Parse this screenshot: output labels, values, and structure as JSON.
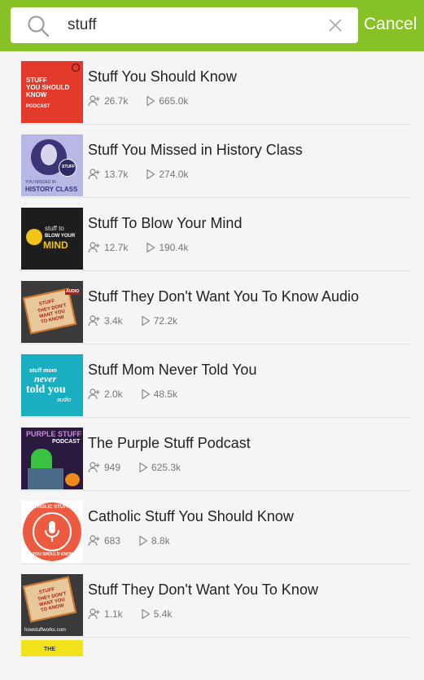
{
  "search": {
    "query": "stuff",
    "cancel_label": "Cancel"
  },
  "colors": {
    "accent": "#86c125",
    "background": "#f5f5f5"
  },
  "results": [
    {
      "title": "Stuff You Should Know",
      "subscribers": "26.7k",
      "plays": "665.0k",
      "art_text": [
        "STUFF",
        "YOU SHOULD",
        "KNOW",
        "PODCAST"
      ]
    },
    {
      "title": "Stuff You Missed in History Class",
      "subscribers": "13.7k",
      "plays": "274.0k",
      "art_text": [
        "STUFF",
        "YOU MISSED IN",
        "HISTORY CLASS"
      ]
    },
    {
      "title": "Stuff To Blow Your Mind",
      "subscribers": "12.7k",
      "plays": "190.4k",
      "art_text": [
        "stuff to",
        "BLOW YOUR",
        "MIND"
      ]
    },
    {
      "title": "Stuff They Don't Want You To Know Audio",
      "subscribers": "3.4k",
      "plays": "72.2k",
      "art_text": [
        "STUFF",
        "THEY DON'T",
        "WANT YOU",
        "TO KNOW",
        "AUDIO"
      ]
    },
    {
      "title": "Stuff Mom Never Told You",
      "subscribers": "2.0k",
      "plays": "48.5k",
      "art_text": [
        "stuff mom",
        "never",
        "told you",
        "audio"
      ]
    },
    {
      "title": "The Purple Stuff Podcast",
      "subscribers": "949",
      "plays": "625.3k",
      "art_text": [
        "PURPLE STUFF",
        "PODCAST"
      ]
    },
    {
      "title": "Catholic Stuff You Should Know",
      "subscribers": "683",
      "plays": "8.8k",
      "art_text": [
        "CATHOLIC STUFF",
        "YOU SHOULD KNOW"
      ]
    },
    {
      "title": "Stuff They Don't Want You To Know",
      "subscribers": "1.1k",
      "plays": "5.4k",
      "art_text": [
        "STUFF",
        "THEY DON'T",
        "WANT YOU",
        "TO KNOW",
        "howstuffworks.com"
      ]
    },
    {
      "title": "",
      "subscribers": "",
      "plays": "",
      "art_text": [
        "THE"
      ]
    }
  ]
}
